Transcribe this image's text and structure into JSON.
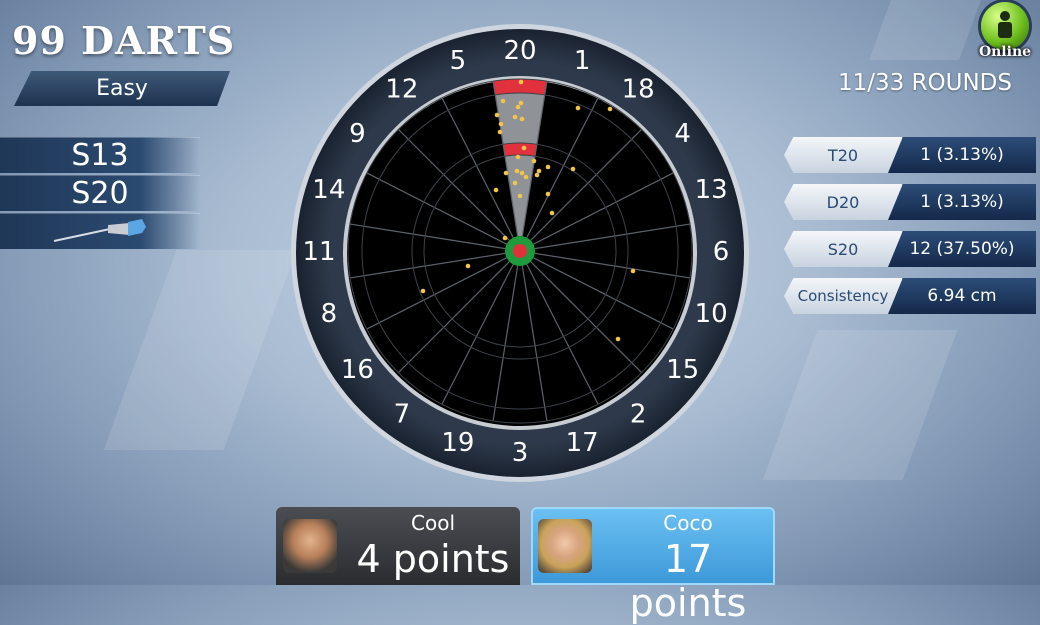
{
  "header": {
    "title": "99 DARTS",
    "difficulty": "Easy"
  },
  "throws": {
    "slots": [
      "S13",
      "S20"
    ]
  },
  "online": {
    "label": "Online"
  },
  "rounds": {
    "text": "11/33 ROUNDS"
  },
  "stats": [
    {
      "label": "T20",
      "value": "1 (3.13%)"
    },
    {
      "label": "D20",
      "value": "1 (3.13%)"
    },
    {
      "label": "S20",
      "value": "12 (37.50%)"
    },
    {
      "label": "Consistency",
      "value": "6.94 cm"
    }
  ],
  "board_numbers": [
    "20",
    "1",
    "18",
    "4",
    "13",
    "6",
    "10",
    "15",
    "2",
    "17",
    "3",
    "19",
    "7",
    "16",
    "8",
    "11",
    "14",
    "9",
    "12",
    "5"
  ],
  "highlighted_segment": "20",
  "players": [
    {
      "name": "Cool",
      "score": "4 points",
      "active": false
    },
    {
      "name": "Coco",
      "score": "17 points",
      "active": true
    }
  ],
  "colors": {
    "accent": "#4ea8e6",
    "highlight": "#e0313c",
    "bull": "#1f9a3c"
  }
}
